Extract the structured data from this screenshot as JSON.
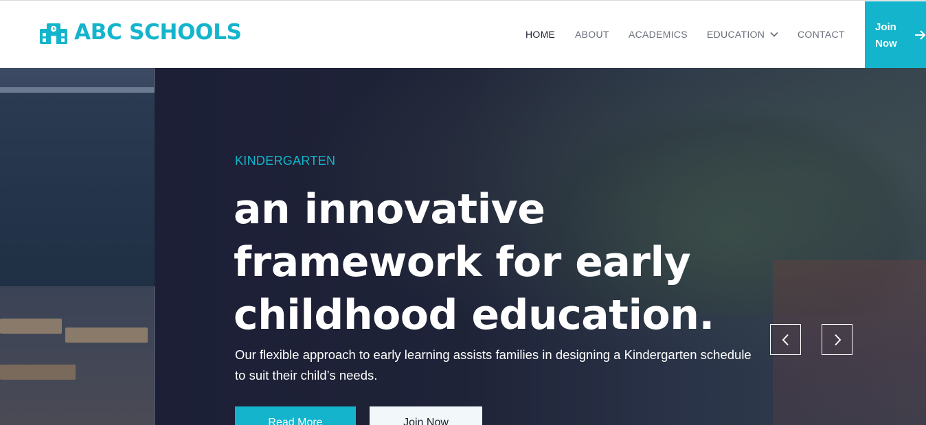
{
  "brand": {
    "name": "ABC SCHOOLS",
    "logo_icon": "school-building-icon",
    "color": "#14b5cc"
  },
  "nav": {
    "items": [
      {
        "label": "HOME",
        "active": true
      },
      {
        "label": "ABOUT",
        "active": false
      },
      {
        "label": "ACADEMICS",
        "active": false
      },
      {
        "label": "EDUCATION",
        "active": false,
        "dropdown_icon": "chevron-down-icon"
      },
      {
        "label": "CONTACT",
        "active": false
      }
    ],
    "cta": {
      "label": "Join Now",
      "icon": "arrow-right-icon"
    }
  },
  "hero": {
    "kicker": "KINDERGARTEN",
    "headline": "an innovative framework for early childhood education.",
    "subtext": "Our flexible approach to early learning assists families in designing a Kindergarten schedule to suit their child’s needs.",
    "primary_button": "Read More",
    "secondary_button": "Join Now",
    "prev_icon": "chevron-left-icon",
    "next_icon": "chevron-right-icon"
  },
  "colors": {
    "accent": "#14b5cc",
    "hero_overlay": "#1c1f35",
    "text_dark": "#1a1f2e",
    "nav_text": "#6a6f7a"
  }
}
